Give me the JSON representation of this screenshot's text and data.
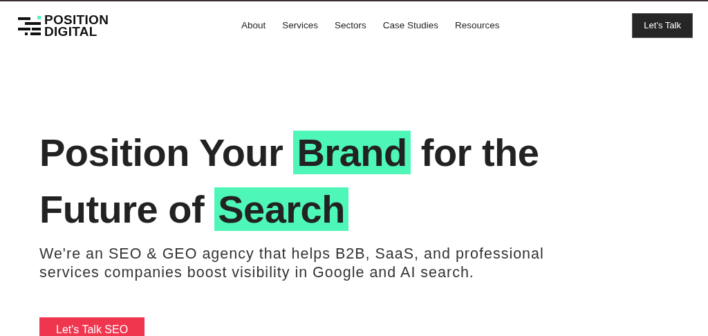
{
  "logo": {
    "lines": [
      "POSITION",
      "DIGITAL"
    ]
  },
  "nav": [
    "About",
    "Services",
    "Sectors",
    "Case Studies",
    "Resources"
  ],
  "cta": "Let’s Talk",
  "hero": {
    "headline": [
      {
        "text": "Position Your ",
        "highlight": false
      },
      {
        "text": "Brand",
        "highlight": true
      },
      {
        "text": " for the Future of ",
        "highlight": false
      },
      {
        "text": "Search",
        "highlight": true
      }
    ],
    "subtitle": "We're an SEO & GEO agency that helps B2B, SaaS, and professional services companies boost visibility in Google and AI search.",
    "button": "Let's Talk SEO"
  }
}
